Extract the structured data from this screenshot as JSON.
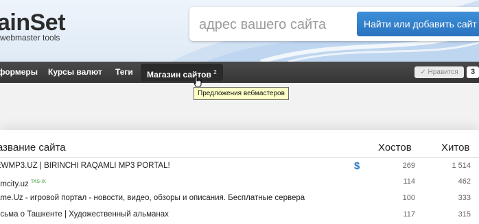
{
  "header": {
    "logo_text": "ainSet",
    "tagline": "webmaster tools",
    "search_placeholder": "адрес вашего сайта",
    "search_button": "Найти или добавить сайт"
  },
  "nav": {
    "items": [
      {
        "label": "формеры"
      },
      {
        "label": "Курсы валют"
      },
      {
        "label": "Теги"
      }
    ],
    "active": {
      "label": "Магазин сайтов",
      "badge": "2"
    },
    "like_label": "✓ Нравится",
    "like_count": "3"
  },
  "tooltip": "Предложения вебмастеров",
  "table": {
    "columns": {
      "name": "азвание сайта",
      "hosts": "Хостов",
      "hits": "Хитов"
    },
    "rows": [
      {
        "name": "EWMP3.UZ | BIRINCHI RAQAMLI MP3 PORTAL!",
        "tag": "",
        "hosts": "269",
        "hits": "1 514",
        "dollar": "$"
      },
      {
        "name": "amcity.uz",
        "tag": "TAS-IX",
        "hosts": "114",
        "hits": "462",
        "dollar": ""
      },
      {
        "name": "ame.Uz - игровой портал - новости, видео, обзоры и описания. Бесплатные сервера",
        "tag": "",
        "hosts": "100",
        "hits": "333",
        "dollar": ""
      },
      {
        "name": "исьма о Ташкенте | Художественный альманах",
        "tag": "",
        "hosts": "117",
        "hits": "315",
        "dollar": ""
      }
    ]
  },
  "colors": {
    "accent": "#2a72bf",
    "nav_bg": "#3a3a3a",
    "tooltip_bg": "#ffffc8",
    "tag": "#3aa03a"
  }
}
